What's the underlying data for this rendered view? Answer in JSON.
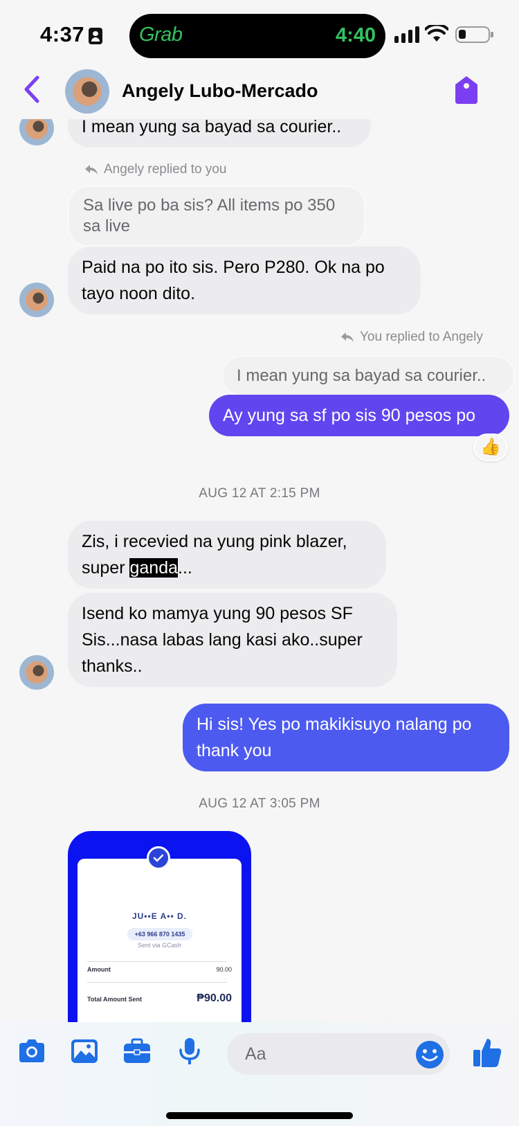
{
  "status_bar": {
    "time": "4:37",
    "island_app": "Grab",
    "island_time": "4:40"
  },
  "header": {
    "contact_name": "Angely Lubo-Mercado"
  },
  "messages": {
    "top_partial": "I mean yung sa bayad sa courier..",
    "reply_label_1": "Angely replied to you",
    "quoted_1": "Sa live po ba sis? All items po 350 sa live",
    "msg_paid": "Paid na po ito sis. Pero P280. Ok na po tayo noon dito.",
    "reply_label_2": "You replied to Angely",
    "quoted_2": "I mean yung sa bayad sa courier..",
    "msg_sf": "Ay yung sa sf po sis 90 pesos po",
    "reaction": "👍",
    "timestamp_1": "AUG 12 AT 2:15 PM",
    "msg_blazer_part1": "Zis, i recevied na yung pink blazer, super ",
    "msg_blazer_highlight": "ganda",
    "msg_blazer_part2": "...",
    "msg_isend": "Isend ko mamya yung 90 pesos SF Sis...nasa labas lang kasi ako..super thanks..",
    "msg_thanks": "Hi sis! Yes po makikisuyo nalang po thank you",
    "timestamp_2": "AUG 12 AT 3:05 PM"
  },
  "receipt": {
    "name": "JU••E A•• D.",
    "phone": "+63 966 870 1435",
    "via": "Sent via GCash",
    "amount_label": "Amount",
    "amount_value": "90.00",
    "total_label": "Total Amount Sent",
    "total_value": "₱90.00"
  },
  "composer": {
    "placeholder": "Aa"
  },
  "colors": {
    "accent_purple": "#7b3ff2",
    "outgoing_blue": "#4d5af0",
    "outgoing_purple": "#6145ee",
    "icon_blue": "#1f6fe5"
  }
}
